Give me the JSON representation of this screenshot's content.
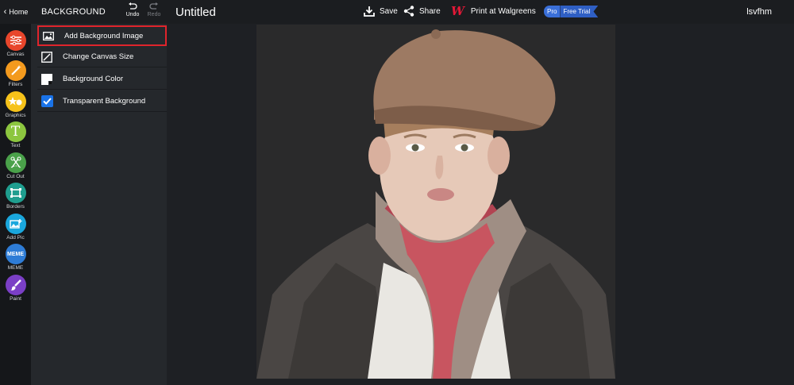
{
  "header": {
    "home_label": "Home",
    "section_title": "BACKGROUND",
    "undo_label": "Undo",
    "redo_label": "Redo",
    "doc_title": "Untitled",
    "save_label": "Save",
    "share_label": "Share",
    "walgreens_label": "Print at Walgreens",
    "pro_label": "Pro",
    "trial_label": "Free Trial",
    "username": "lsvfhm"
  },
  "tools": [
    {
      "label": "Canvas",
      "color": "#e8462c",
      "icon": "sliders-icon"
    },
    {
      "label": "Filters",
      "color": "#f39a1e",
      "icon": "wand-icon"
    },
    {
      "label": "Graphics",
      "color": "#f6c21a",
      "icon": "shapes-icon"
    },
    {
      "label": "Text",
      "color": "#8cc63f",
      "icon": "text-icon"
    },
    {
      "label": "Cut Out",
      "color": "#4aa14a",
      "icon": "scissors-icon"
    },
    {
      "label": "Borders",
      "color": "#1f9e8f",
      "icon": "frame-icon"
    },
    {
      "label": "Add Pic",
      "color": "#1aa7dd",
      "icon": "add-photo-icon"
    },
    {
      "label": "MEME",
      "color": "#2e7cd6",
      "icon": "meme-icon",
      "badge": "MEME"
    },
    {
      "label": "Paint",
      "color": "#7b3fc6",
      "icon": "brush-icon"
    }
  ],
  "panel": {
    "items": [
      {
        "label": "Add Background Image",
        "icon": "image-icon",
        "selected": true
      },
      {
        "label": "Change Canvas Size",
        "icon": "resize-icon",
        "selected": false
      },
      {
        "label": "Background Color",
        "icon": "color-swatch-icon",
        "selected": false
      },
      {
        "label": "Transparent Background",
        "icon": "checkbox-icon",
        "selected": false,
        "checked": true
      }
    ]
  },
  "colors": {
    "accent_red": "#e0242c",
    "walgreens_red": "#e31837",
    "pro_blue": "#3a6fd8",
    "checkbox_blue": "#1a73e8"
  }
}
